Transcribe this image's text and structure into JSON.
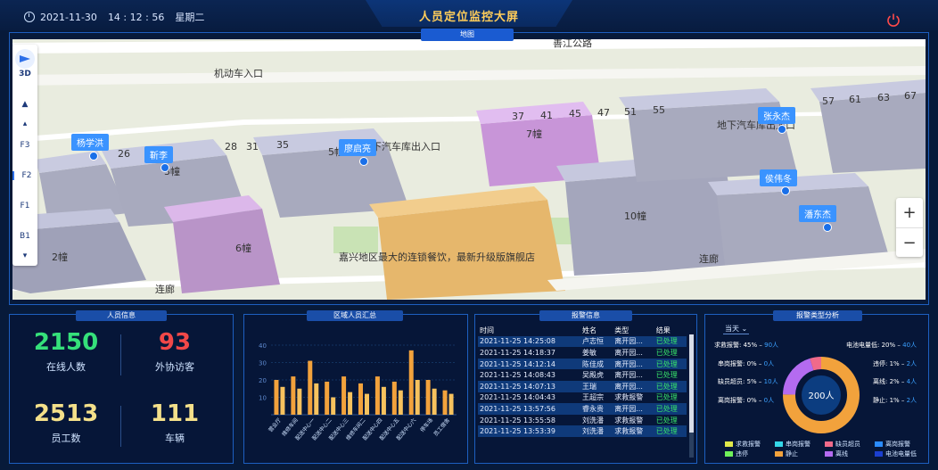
{
  "header": {
    "date": "2021-11-30",
    "time": "14 : 12 : 56",
    "weekday": "星期二",
    "title": "人员定位监控大屏",
    "map_tab": "地图"
  },
  "map": {
    "floors": [
      "3D",
      "F3",
      "F2",
      "F1",
      "B1"
    ],
    "active_floor": "F2",
    "zoom_in": "+",
    "zoom_out": "−",
    "place_labels": [
      {
        "text": "善江公路"
      },
      {
        "text": "机动车入口"
      },
      {
        "text": "地下汽车库出入口"
      },
      {
        "text": "地下汽车库出入口"
      },
      {
        "text": "嘉兴地区最大的连锁餐饮，最新升级版旗舰店"
      },
      {
        "text": "连廊"
      },
      {
        "text": "连廊"
      },
      {
        "text": "2幢"
      },
      {
        "text": "6幢"
      },
      {
        "text": "7幢"
      },
      {
        "text": "10幢"
      },
      {
        "text": "5幢"
      },
      {
        "text": "3幢"
      }
    ],
    "numbers": [
      "26",
      "28",
      "31",
      "35",
      "37",
      "41",
      "45",
      "47",
      "51",
      "55",
      "57",
      "61",
      "63",
      "67"
    ],
    "persons": [
      "杨学洪",
      "靳李",
      "廖启亮",
      "张永杰",
      "侯伟冬",
      "潘东杰"
    ]
  },
  "personnel": {
    "title": "人员信息",
    "online_count": "2150",
    "online_label": "在线人数",
    "visitor_count": "93",
    "visitor_label": "外协访客",
    "staff_count": "2513",
    "staff_label": "员工数",
    "vehicle_count": "111",
    "vehicle_label": "车辆"
  },
  "region_chart_title": "区域人员汇总",
  "chart_data": {
    "type": "bar",
    "title": "区域人员汇总",
    "ylim": [
      0,
      40
    ],
    "yticks": [
      "40",
      "30",
      "20",
      "10"
    ],
    "categories": [
      "营业厅",
      "维修车间",
      "配送中心一",
      "配送中心二",
      "配送中心三",
      "维修车间二",
      "配送中心四",
      "配送中心五",
      "配送中心六",
      "停车场",
      "员工宿舍"
    ],
    "series": [
      {
        "values": [
          20,
          22,
          31,
          19,
          22,
          18,
          22,
          19,
          37,
          20,
          14
        ]
      },
      {
        "values": [
          16,
          15,
          18,
          10,
          13,
          12,
          16,
          14,
          20,
          15,
          12
        ]
      }
    ]
  },
  "alarm": {
    "title": "报警信息",
    "columns": [
      "时间",
      "姓名",
      "类型",
      "结果"
    ],
    "rows": [
      [
        "2021-11-25 14:25:08",
        "卢志恒",
        "离开园...",
        "已处理"
      ],
      [
        "2021-11-25 14:18:37",
        "姜敏",
        "离开园...",
        "已处理"
      ],
      [
        "2021-11-25 14:12:14",
        "陈佳成",
        "离开园...",
        "已处理"
      ],
      [
        "2021-11-25 14:08:43",
        "吴殿虎",
        "离开园...",
        "已处理"
      ],
      [
        "2021-11-25 14:07:13",
        "王瑞",
        "离开园...",
        "已处理"
      ],
      [
        "2021-11-25 14:04:43",
        "王超宗",
        "求救报警",
        "已处理"
      ],
      [
        "2021-11-25 13:57:56",
        "睿永贵",
        "离开园...",
        "已处理"
      ],
      [
        "2021-11-25 13:55:58",
        "刘洗潘",
        "求救报警",
        "已处理"
      ],
      [
        "2021-11-25 13:53:39",
        "刘洗潘",
        "求救报警",
        "已处理"
      ]
    ]
  },
  "alarm_type": {
    "title": "报警类型分析",
    "period": "当天",
    "center": "200人",
    "items": [
      {
        "label": "求救报警",
        "pct": "45%",
        "count": "90人",
        "color": "#e0e84a"
      },
      {
        "label": "串岗报警",
        "pct": "0%",
        "count": "0人",
        "color": "#34d7e8"
      },
      {
        "label": "缺员超员",
        "pct": "5%",
        "count": "10人",
        "color": "#f06a8a"
      },
      {
        "label": "离岗报警",
        "pct": "0%",
        "count": "0人",
        "color": "#2b8cff"
      },
      {
        "label": "电池电量低",
        "pct": "20%",
        "count": "40人",
        "color": "#1b3fcf"
      },
      {
        "label": "违停",
        "pct": "1%",
        "count": "2人",
        "color": "#6ff05a"
      },
      {
        "label": "离线",
        "pct": "2%",
        "count": "4人",
        "color": "#b46bf0"
      },
      {
        "label": "静止",
        "pct": "1%",
        "count": "2人",
        "color": "#f2a23c"
      }
    ]
  }
}
